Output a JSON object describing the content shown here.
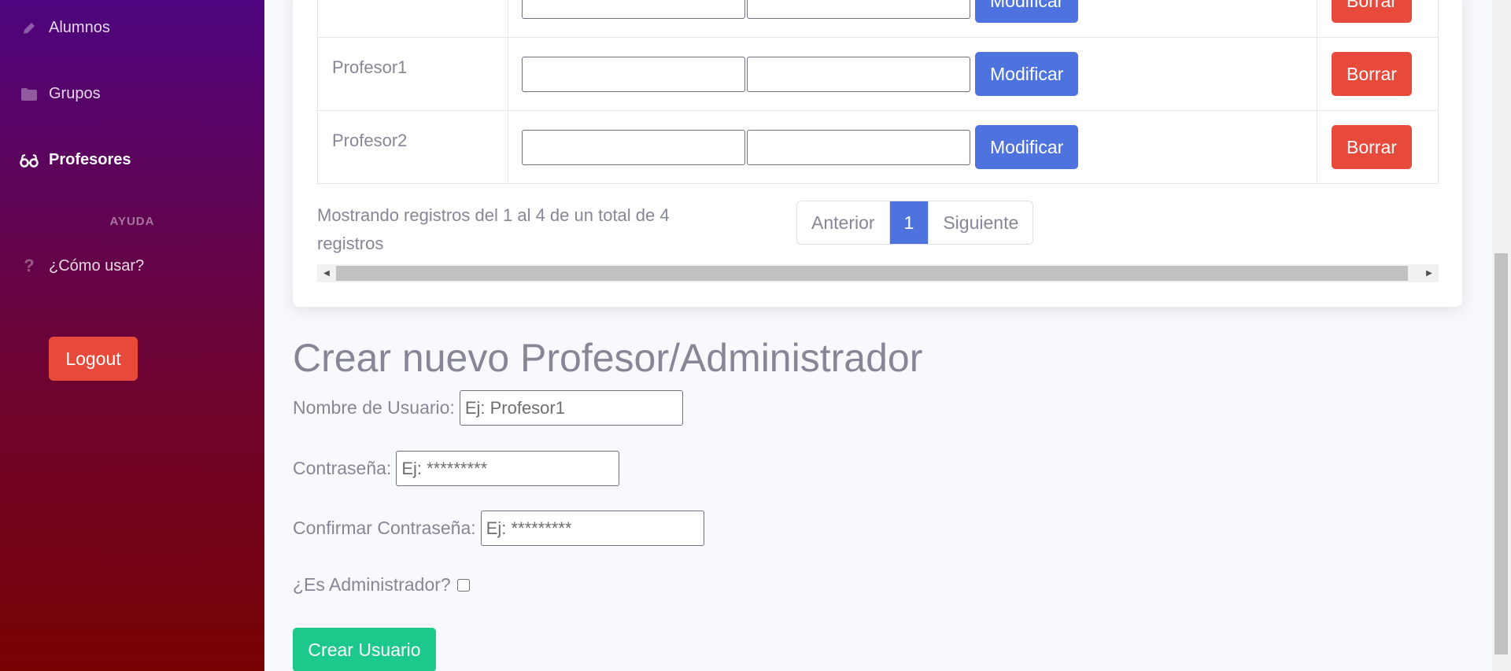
{
  "sidebar": {
    "items": [
      {
        "label": "Alumnos",
        "icon": "pencil-icon"
      },
      {
        "label": "Grupos",
        "icon": "folder-icon"
      },
      {
        "label": "Profesores",
        "icon": "glasses-icon",
        "active": true
      }
    ],
    "help_heading": "AYUDA",
    "help_item": {
      "label": "¿Cómo usar?",
      "icon": "question-icon"
    },
    "logout_label": "Logout"
  },
  "table": {
    "rows": [
      {
        "name": "",
        "modify_label": "Modificar",
        "delete_label": "Borrar"
      },
      {
        "name": "Profesor1",
        "modify_label": "Modificar",
        "delete_label": "Borrar"
      },
      {
        "name": "Profesor2",
        "modify_label": "Modificar",
        "delete_label": "Borrar"
      }
    ],
    "info": "Mostrando registros del 1 al 4 de un total de 4 registros",
    "pagination": {
      "prev": "Anterior",
      "current": "1",
      "next": "Siguiente"
    }
  },
  "form": {
    "title": "Crear nuevo Profesor/Administrador",
    "username_label": "Nombre de Usuario:",
    "username_placeholder": "Ej: Profesor1",
    "password_label": "Contraseña:",
    "password_placeholder": "Ej: *********",
    "confirm_label": "Confirmar Contraseña:",
    "confirm_placeholder": "Ej: *********",
    "admin_label": "¿Es Administrador?",
    "submit_label": "Crear Usuario"
  },
  "colors": {
    "primary": "#4e73df",
    "danger": "#e74a3b",
    "success": "#1cc88a",
    "sidebar_top": "#4e047f",
    "sidebar_bottom": "#780202"
  }
}
